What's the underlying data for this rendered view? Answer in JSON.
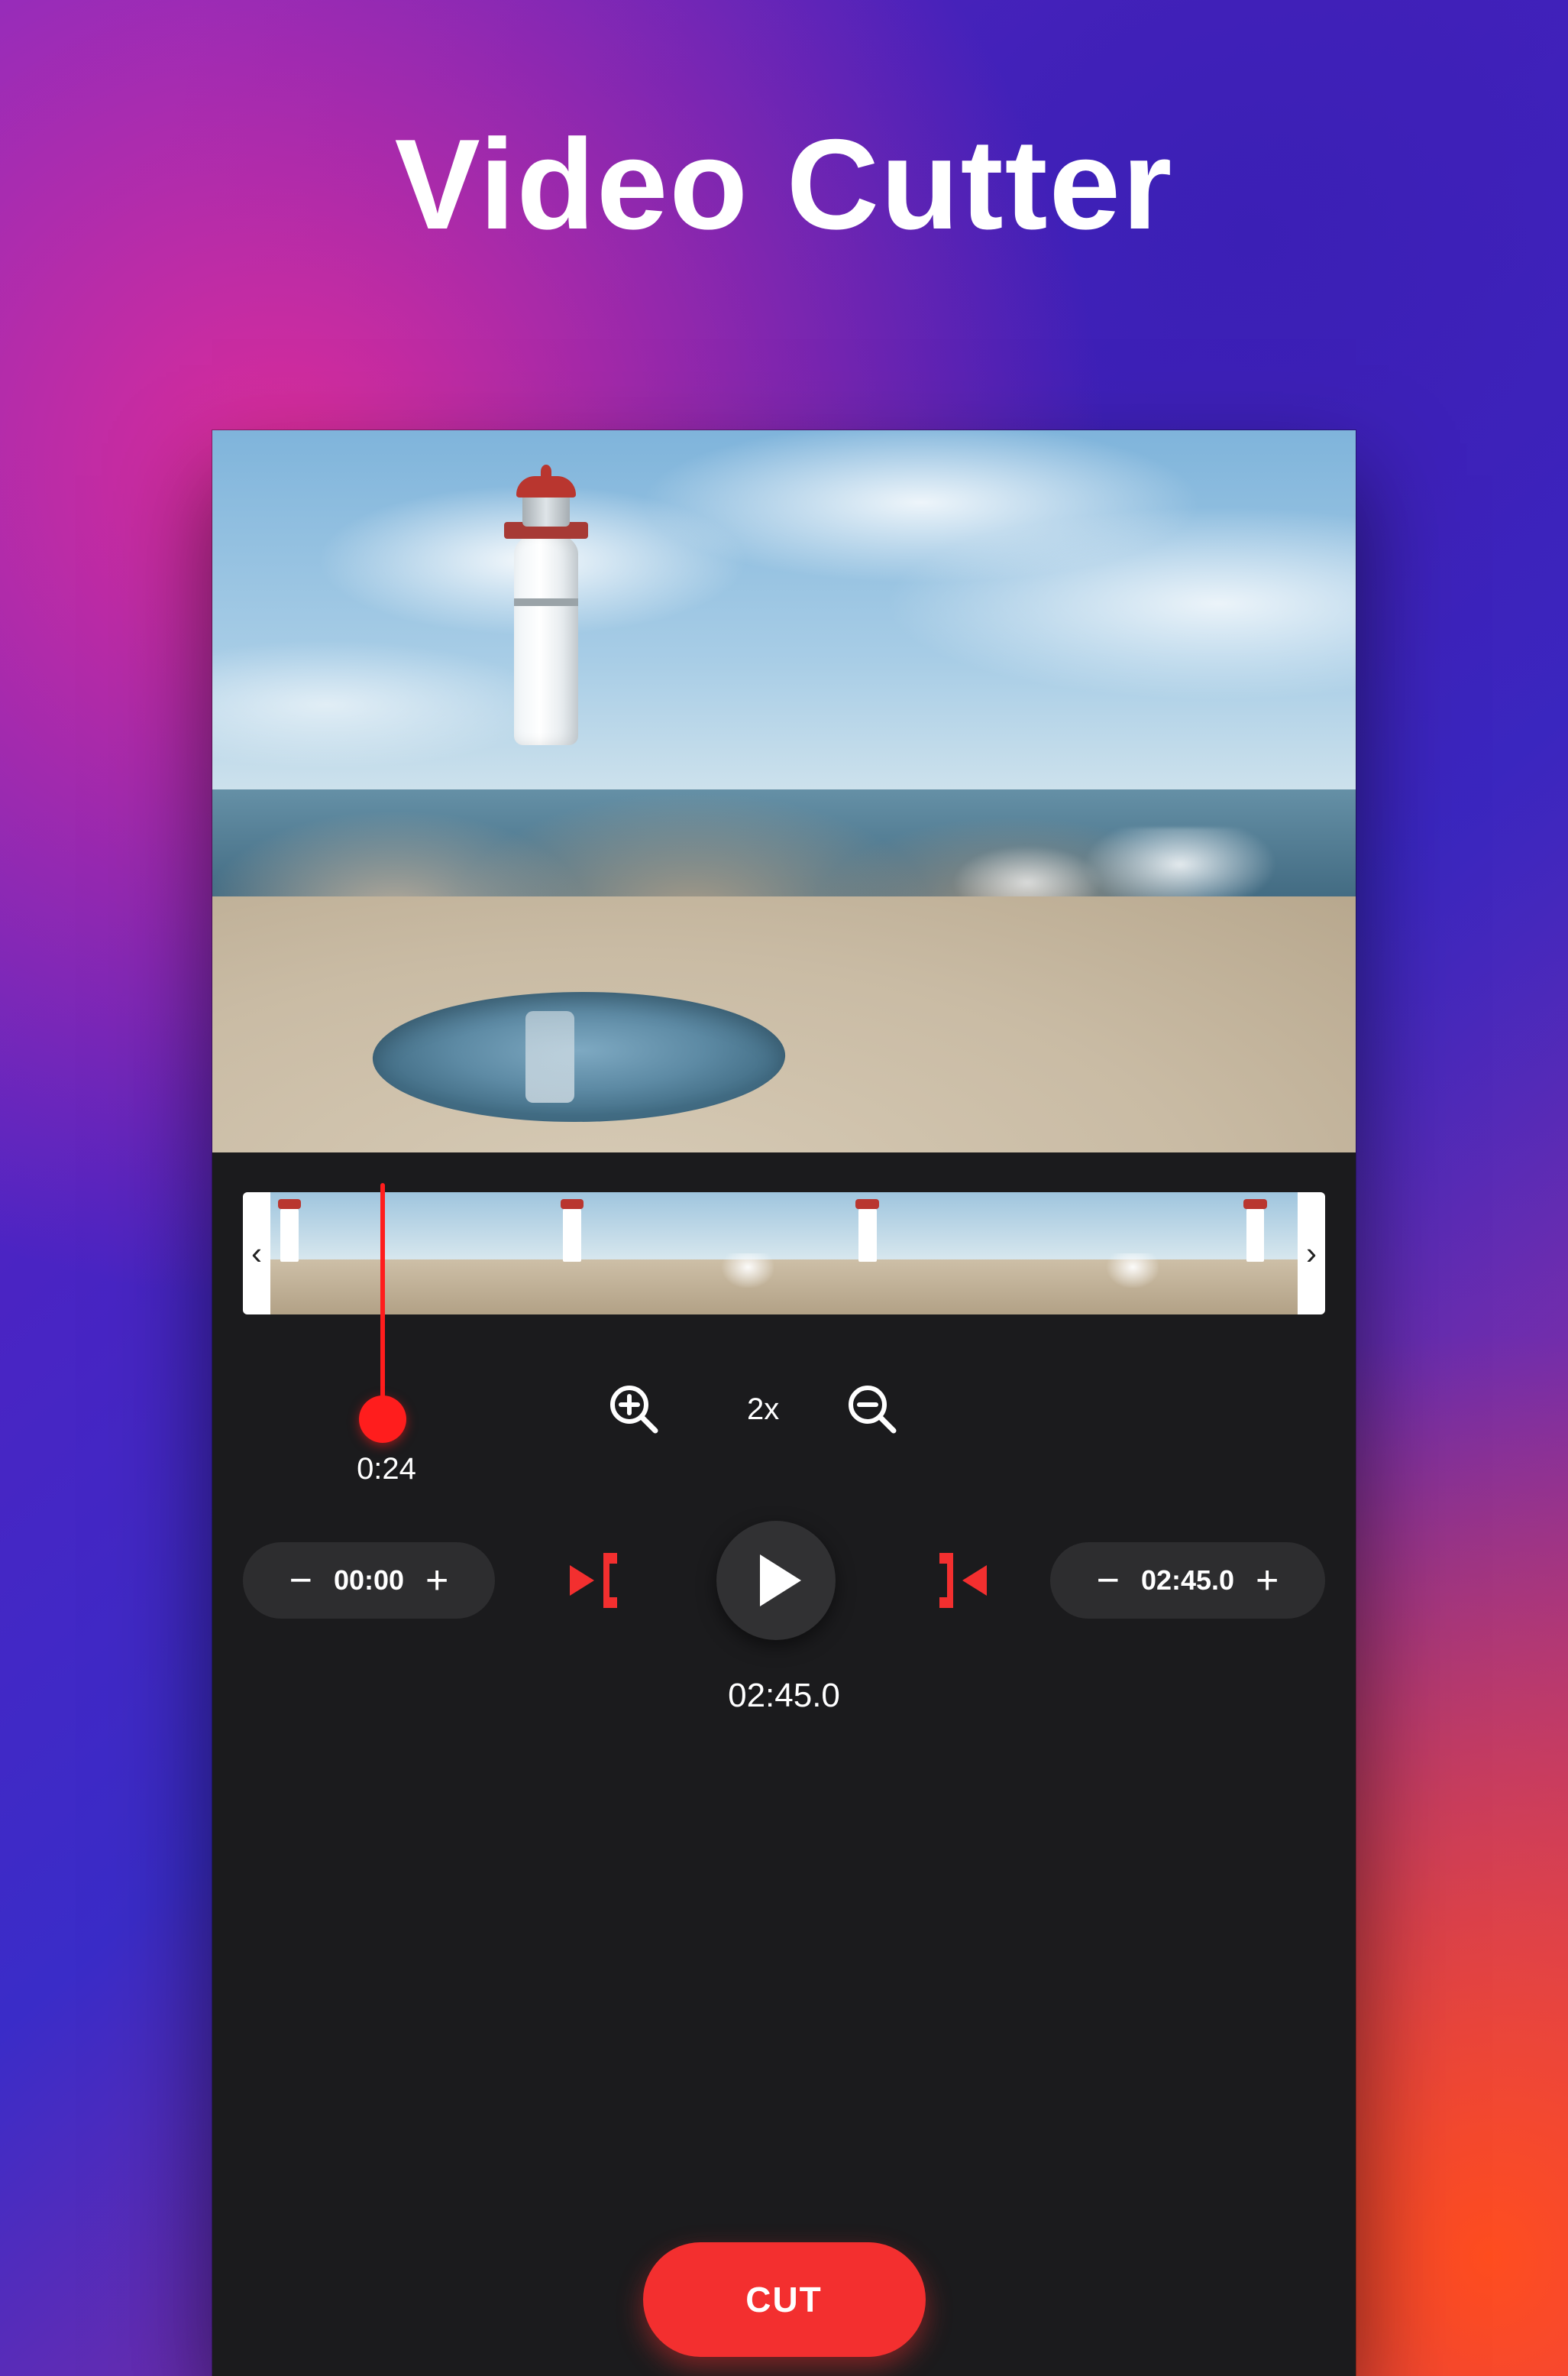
{
  "title": "Video Cutter",
  "timeline": {
    "left_arrow": "‹",
    "right_arrow": "›",
    "playhead_time": "0:24"
  },
  "zoom": {
    "label": "2x"
  },
  "transport": {
    "start_time": "00:00",
    "end_time": "02:45.0",
    "duration": "02:45.0",
    "minus": "−",
    "plus": "+"
  },
  "cut_label": "CUT",
  "icons": {
    "zoom_in": "zoom-in-icon",
    "zoom_out": "zoom-out-icon",
    "trim_left": "trim-left-icon",
    "trim_right": "trim-right-icon",
    "play": "play-icon"
  }
}
